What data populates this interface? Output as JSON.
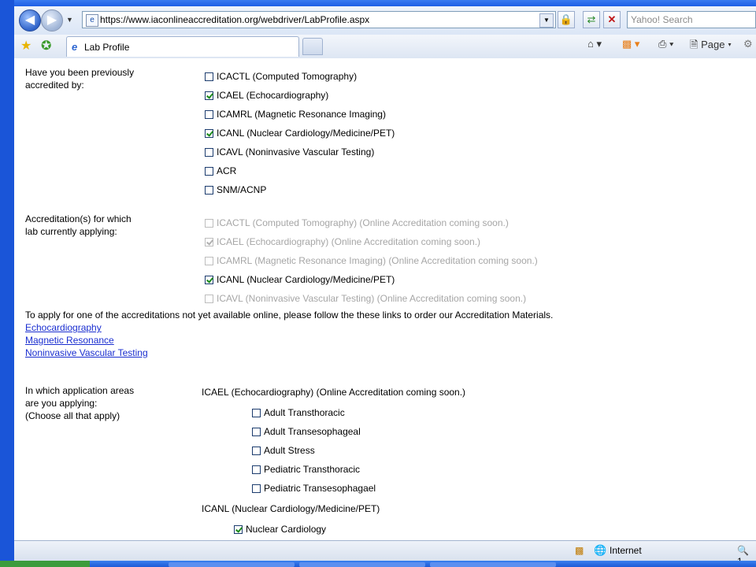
{
  "browser": {
    "url": "https://www.iaconlineaccreditation.org/webdriver/LabProfile.aspx",
    "search_placeholder": "Yahoo! Search",
    "tab_title": "Lab Profile",
    "page_menu": "Page",
    "status_zone": "Internet",
    "zoom": "1"
  },
  "form": {
    "prev_label_1": "Have you been previously",
    "prev_label_2": "accredited by:",
    "prev_options": [
      {
        "label": "ICACTL (Computed Tomography)",
        "checked": false
      },
      {
        "label": "ICAEL (Echocardiography)",
        "checked": true
      },
      {
        "label": "ICAMRL (Magnetic Resonance Imaging)",
        "checked": false
      },
      {
        "label": "ICANL (Nuclear Cardiology/Medicine/PET)",
        "checked": true
      },
      {
        "label": "ICAVL (Noninvasive Vascular Testing)",
        "checked": false
      },
      {
        "label": "ACR",
        "checked": false
      },
      {
        "label": "SNM/ACNP",
        "checked": false
      }
    ],
    "applying_label_1": "Accreditation(s) for which",
    "applying_label_2": "lab currently applying:",
    "applying_options": [
      {
        "label": "ICACTL (Computed Tomography) (Online Accreditation coming soon.)",
        "checked": false,
        "disabled": true
      },
      {
        "label": "ICAEL (Echocardiography) (Online Accreditation coming soon.)",
        "checked": true,
        "disabled": true
      },
      {
        "label": "ICAMRL (Magnetic Resonance Imaging) (Online Accreditation coming soon.)",
        "checked": false,
        "disabled": true
      },
      {
        "label": "ICANL (Nuclear Cardiology/Medicine/PET)",
        "checked": true,
        "disabled": false
      },
      {
        "label": "ICAVL (Noninvasive Vascular Testing) (Online Accreditation coming soon.)",
        "checked": false,
        "disabled": true
      }
    ],
    "info_text": "To apply for one of the accreditations not yet available online, please follow the these links to order our Accreditation Materials.",
    "links": [
      "Echocardiography",
      "Magnetic Resonance",
      "Noninvasive Vascular Testing"
    ],
    "areas_label_1": "In which application areas",
    "areas_label_2": "are you applying:",
    "areas_label_3": "(Choose all that apply)",
    "icael_heading": "ICAEL (Echocardiography) (Online Accreditation coming soon.)",
    "icael_areas": [
      {
        "label": "Adult Transthoracic",
        "checked": false
      },
      {
        "label": "Adult Transesophageal",
        "checked": false
      },
      {
        "label": "Adult Stress",
        "checked": false
      },
      {
        "label": "Pediatric Transthoracic",
        "checked": false
      },
      {
        "label": "Pediatric Transesophagael",
        "checked": false
      }
    ],
    "icanl_heading": "ICANL (Nuclear Cardiology/Medicine/PET)",
    "icanl_areas": [
      {
        "label": "Nuclear Cardiology",
        "checked": true
      }
    ]
  }
}
